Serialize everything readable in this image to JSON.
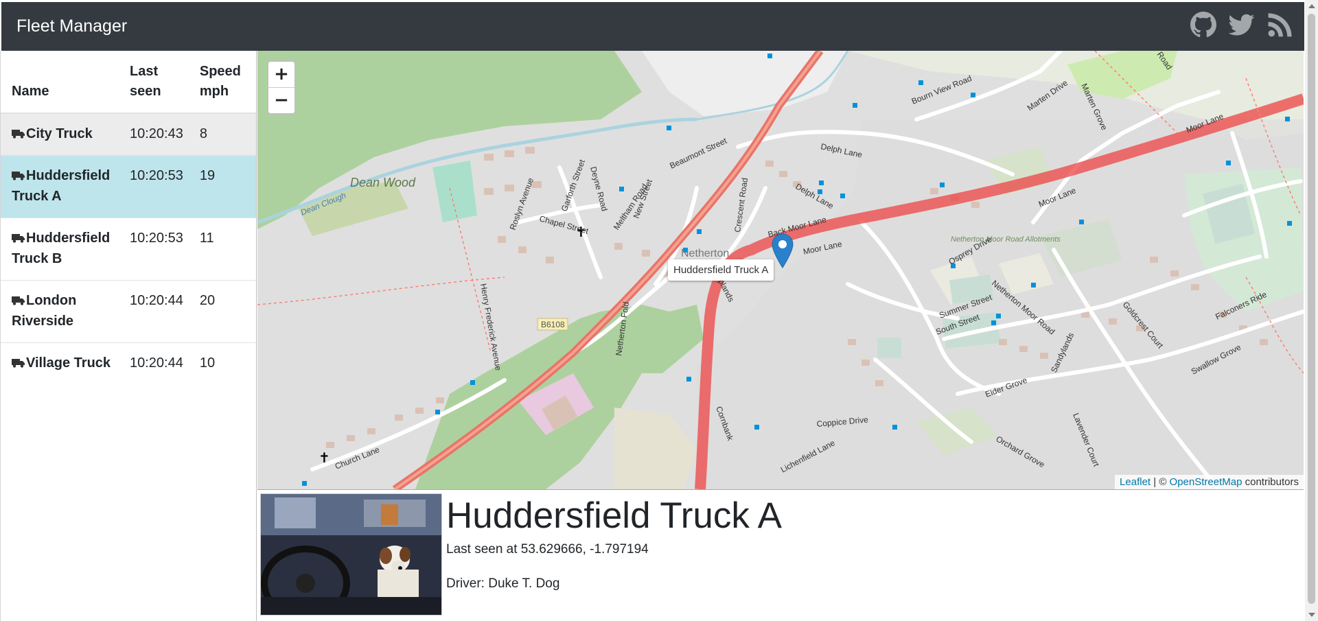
{
  "navbar": {
    "brand": "Fleet Manager",
    "icons": [
      "github-icon",
      "twitter-icon",
      "rss-icon"
    ]
  },
  "table": {
    "headers": [
      "Name",
      "Last seen",
      "Speed mph"
    ],
    "rows": [
      {
        "name": "City Truck",
        "last_seen": "10:20:43",
        "speed": "8",
        "state": "hover"
      },
      {
        "name": "Huddersfield Truck A",
        "last_seen": "10:20:53",
        "speed": "19",
        "state": "active"
      },
      {
        "name": "Huddersfield Truck B",
        "last_seen": "10:20:53",
        "speed": "11",
        "state": ""
      },
      {
        "name": "London Riverside",
        "last_seen": "10:20:44",
        "speed": "20",
        "state": ""
      },
      {
        "name": "Village Truck",
        "last_seen": "10:20:44",
        "speed": "10",
        "state": ""
      }
    ]
  },
  "map": {
    "zoom_in": "+",
    "zoom_out": "−",
    "marker_tooltip": "Huddersfield Truck A",
    "attribution": {
      "leaflet": "Leaflet",
      "separator": " | © ",
      "osm": "OpenStreetMap",
      "suffix": " contributors"
    },
    "labels": {
      "dean_wood": "Dean Wood",
      "dean_clough": "Dean Clough",
      "netherton": "Netherton",
      "bourn_view": "Bourn View Road",
      "marten_drive": "Marten Drive",
      "marten_grove": "Marten Grove",
      "road_top": "Road",
      "delph_lane": "Delph Lane",
      "moor_lane_e": "Moor Lane",
      "moor_lane_mid": "Moor Lane",
      "moor_lane_w": "Moor Lane",
      "meltham_road": "Meltham Road",
      "beaumont_street": "Beaumont Street",
      "crescent_road": "Crescent Road",
      "delph_lane2": "Delph Lane",
      "back_moor_lane": "Back Moor Lane",
      "allotments": "Netherton Moor Road Allotments",
      "osprey_drive": "Osprey Drive",
      "chapel_street": "Chapel Street",
      "garforth_street": "Garforth Street",
      "deyne_road": "Deyne Road",
      "roslyn_avenue": "Roslyn Avenue",
      "new_street": "New Street",
      "henry_frederick": "Henry Frederick Avenue",
      "b6108": "B6108",
      "netherton_fold": "Netherton Fold",
      "uplands": "Uplands",
      "summer_street": "Summer Street",
      "south_street": "South Street",
      "netherton_moor_road": "Netherton Moor Road",
      "goldcrest_court": "Goldcrest Court",
      "falconers_ride": "Falconers Ride",
      "swallow_grove": "Swallow Grove",
      "sandylands": "Sandylands",
      "elder_grove": "Elder Grove",
      "coppice_drive": "Coppice Drive",
      "cornbank": "Cornbank",
      "lichenfield_lane": "Lichenfield Lane",
      "orchard_grove": "Orchard Grove",
      "lavender_court": "Lavender Court",
      "church_lane": "Church Lane"
    }
  },
  "details": {
    "title": "Huddersfield Truck A",
    "last_seen": "Last seen at 53.629666, -1.797194",
    "driver": "Driver: Duke T. Dog"
  },
  "colors": {
    "navbar": "#343a40",
    "active_row": "#bee5eb",
    "hover_row": "#ececec",
    "marker": "#2a81cb",
    "main_road": "#e8746a",
    "route": "#ee4444",
    "link": "#0078a8"
  }
}
